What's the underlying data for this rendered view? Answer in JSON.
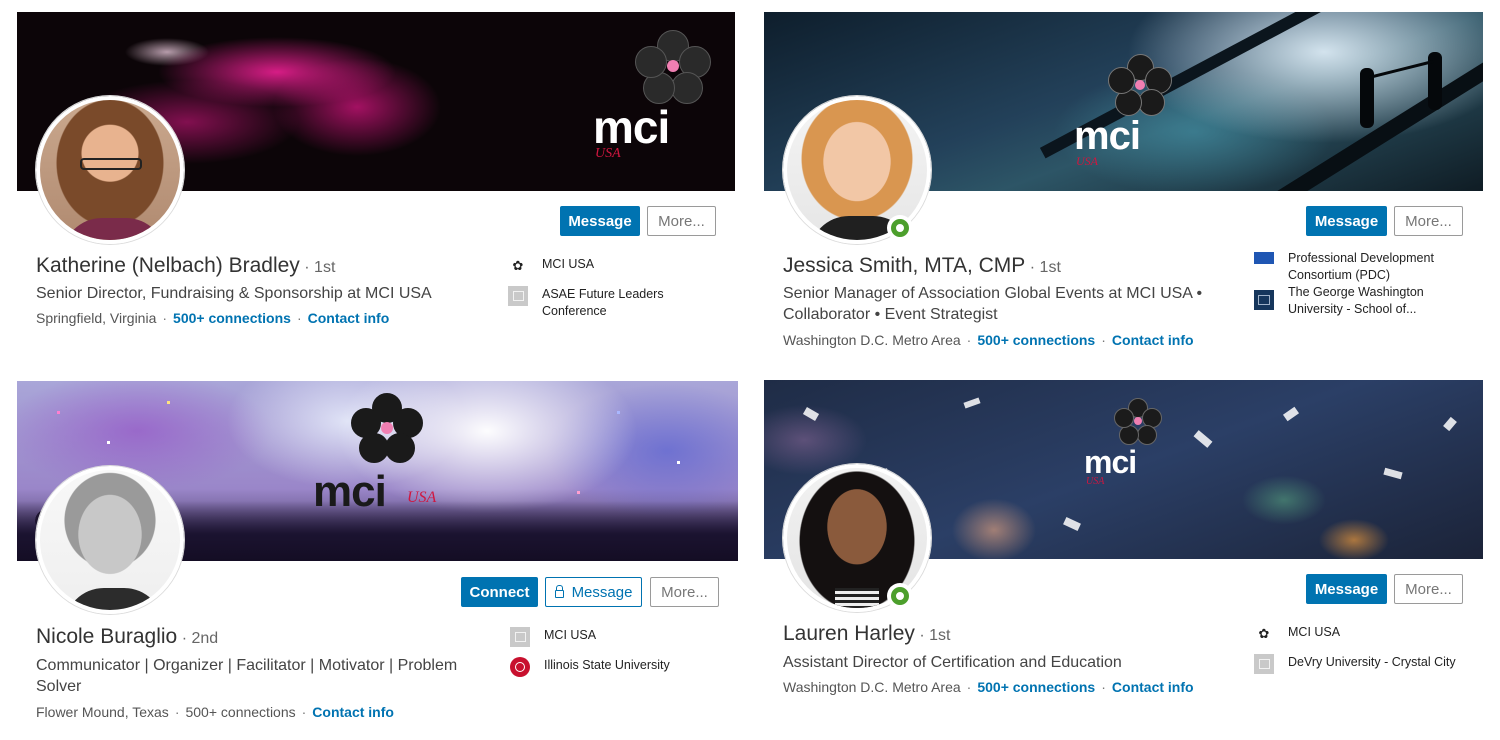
{
  "profiles": [
    {
      "name": "Katherine (Nelbach) Bradley",
      "degree": "1st",
      "headline": "Senior Director, Fundraising & Sponsorship at MCI USA",
      "location": "Springfield, Virginia",
      "connections": "500+ connections",
      "contact": "Contact info",
      "buttons": {
        "message": "Message",
        "more": "More..."
      },
      "side": [
        {
          "icon": "mci-logo-icon",
          "text": "MCI USA"
        },
        {
          "icon": "school-icon",
          "text": "ASAE Future Leaders Conference"
        }
      ]
    },
    {
      "name": "Jessica Smith, MTA, CMP",
      "degree": "1st",
      "headline": "Senior Manager of Association Global Events at MCI USA • Collaborator • Event Strategist",
      "location": "Washington D.C. Metro Area",
      "connections": "500+ connections",
      "contact": "Contact info",
      "buttons": {
        "message": "Message",
        "more": "More..."
      },
      "side": [
        {
          "icon": "pdc-logo-icon",
          "text": "Professional Development Consortium (PDC)"
        },
        {
          "icon": "gwu-logo-icon",
          "text": "The George Washington University - School of..."
        }
      ]
    },
    {
      "name": "Nicole Buraglio",
      "degree": "2nd",
      "headline": "Communicator | Organizer | Facilitator | Motivator | Problem Solver",
      "location": "Flower Mound, Texas",
      "connections": "500+ connections",
      "contact": "Contact info",
      "buttons": {
        "connect": "Connect",
        "message": "Message",
        "more": "More..."
      },
      "side": [
        {
          "icon": "company-icon",
          "text": "MCI USA"
        },
        {
          "icon": "isu-logo-icon",
          "text": "Illinois State University"
        }
      ]
    },
    {
      "name": "Lauren Harley",
      "degree": "1st",
      "headline": "Assistant Director of Certification and Education",
      "location": "Washington D.C. Metro Area",
      "connections": "500+ connections",
      "contact": "Contact info",
      "buttons": {
        "message": "Message",
        "more": "More..."
      },
      "side": [
        {
          "icon": "mci-logo-icon",
          "text": "MCI USA"
        },
        {
          "icon": "school-icon",
          "text": "DeVry University - Crystal City"
        }
      ]
    }
  ],
  "brand": {
    "logo_text": "mci",
    "logo_sub": "USA",
    "primary": "#0073b1",
    "online": "#4c9f2c",
    "accent_pink": "#f07fb2"
  },
  "dot": "·"
}
